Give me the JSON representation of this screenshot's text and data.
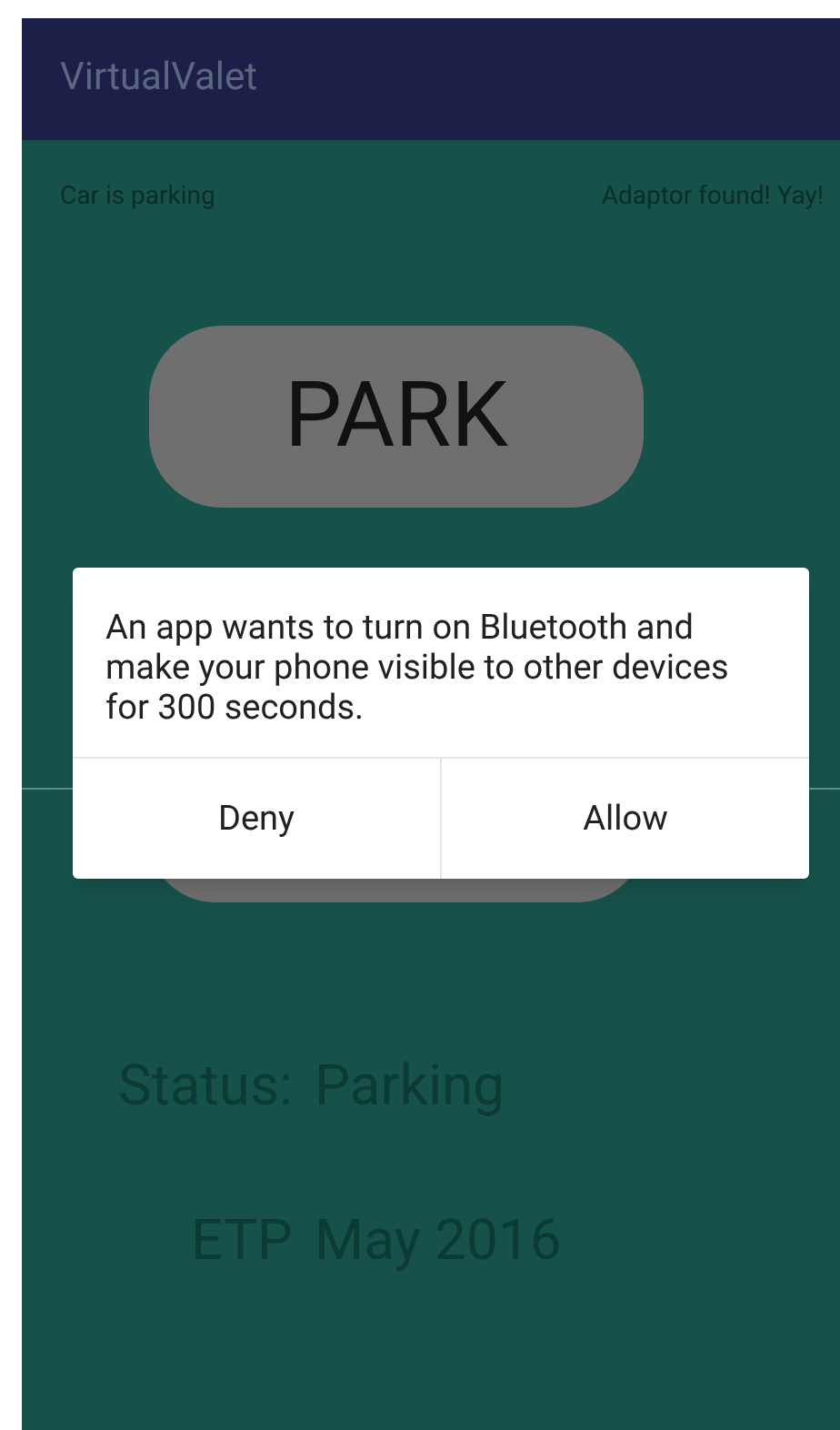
{
  "app_bar": {
    "title": "VirtualValet"
  },
  "status_left": "Car is parking",
  "status_right": "Adaptor found! Yay!",
  "park_button": {
    "label": "PARK"
  },
  "info": [
    {
      "label": "Status:",
      "value": "Parking"
    },
    {
      "label": "ETP",
      "value": "May 2016"
    }
  ],
  "dialog": {
    "message": "An app wants to turn on Bluetooth and make your phone visible to other devices for 300 seconds.",
    "buttons": [
      "Deny",
      "Allow"
    ]
  }
}
